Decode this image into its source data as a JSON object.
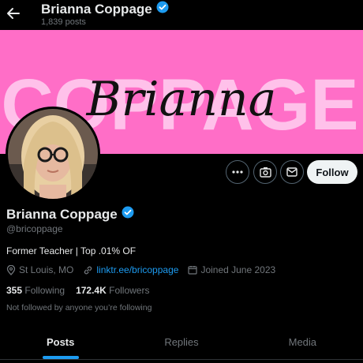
{
  "header": {
    "name": "Brianna Coppage",
    "posts_count": "1,839 posts"
  },
  "banner": {
    "big_text": "COPPAGE",
    "script_text": "Brianna",
    "color": "#ff6ec7"
  },
  "actions": {
    "follow_label": "Follow"
  },
  "profile": {
    "name": "Brianna Coppage",
    "handle": "@bricoppage",
    "bio": "Former Teacher | Top .01% OF",
    "location": "St Louis, MO",
    "link": "linktr.ee/bricoppage",
    "joined": "Joined June 2023",
    "following_count": "355",
    "following_label": "Following",
    "followers_count": "172.4K",
    "followers_label": "Followers",
    "note": "Not followed by anyone you’re following"
  },
  "tabs": [
    {
      "label": "Posts",
      "active": true
    },
    {
      "label": "Replies",
      "active": false
    },
    {
      "label": "Media",
      "active": false
    }
  ],
  "colors": {
    "accent": "#1d9bf0",
    "verified": "#1d9bf0"
  }
}
